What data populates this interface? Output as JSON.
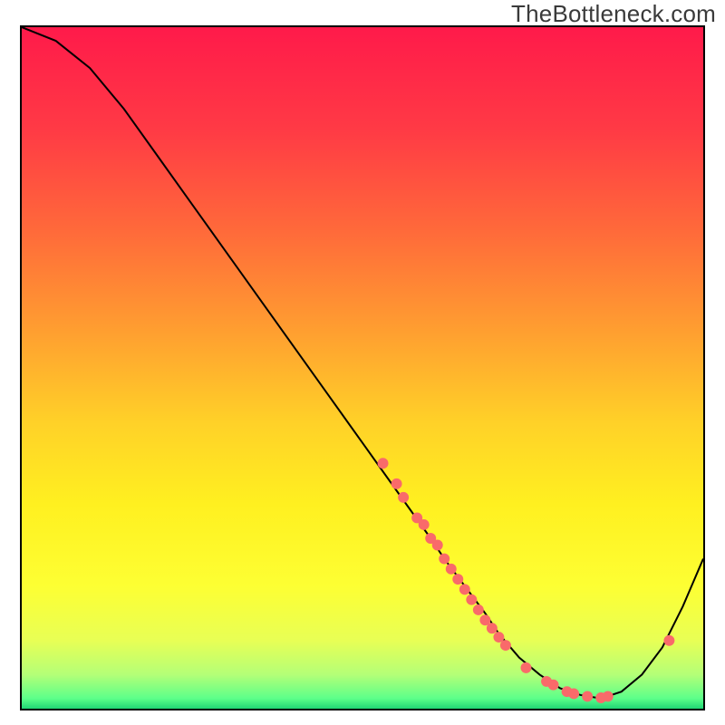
{
  "attribution": "TheBottleneck.com",
  "chart_data": {
    "type": "line",
    "title": "",
    "xlabel": "",
    "ylabel": "",
    "xlim": [
      0,
      100
    ],
    "ylim": [
      0,
      100
    ],
    "grid": false,
    "legend": false,
    "background_gradient": {
      "stops": [
        {
          "pos": 0.0,
          "color": "#ff1a4a"
        },
        {
          "pos": 0.15,
          "color": "#ff3a45"
        },
        {
          "pos": 0.3,
          "color": "#ff6a3a"
        },
        {
          "pos": 0.45,
          "color": "#ffa030"
        },
        {
          "pos": 0.58,
          "color": "#ffd128"
        },
        {
          "pos": 0.7,
          "color": "#fff020"
        },
        {
          "pos": 0.82,
          "color": "#fdff33"
        },
        {
          "pos": 0.9,
          "color": "#e8ff55"
        },
        {
          "pos": 0.95,
          "color": "#b4ff77"
        },
        {
          "pos": 0.985,
          "color": "#5cff8a"
        },
        {
          "pos": 1.0,
          "color": "#20d574"
        }
      ]
    },
    "series": [
      {
        "name": "bottleneck-curve",
        "color": "#000000",
        "x": [
          0,
          5,
          10,
          15,
          20,
          25,
          30,
          35,
          40,
          45,
          50,
          55,
          60,
          62,
          65,
          68,
          70,
          73,
          76,
          79,
          82,
          85,
          88,
          91,
          94,
          97,
          100
        ],
        "y": [
          100,
          98,
          94,
          88,
          81,
          74,
          67,
          60,
          53,
          46,
          39,
          32,
          25,
          22,
          18,
          14,
          11,
          7.5,
          5,
          3,
          2,
          1.5,
          2.5,
          5,
          9,
          15,
          22
        ]
      }
    ],
    "markers": [
      {
        "name": "dots",
        "color": "#f96a6a",
        "radius": 6,
        "points": [
          {
            "x": 53,
            "y": 36
          },
          {
            "x": 55,
            "y": 33
          },
          {
            "x": 56,
            "y": 31
          },
          {
            "x": 58,
            "y": 28
          },
          {
            "x": 59,
            "y": 27
          },
          {
            "x": 60,
            "y": 25
          },
          {
            "x": 61,
            "y": 24
          },
          {
            "x": 62,
            "y": 22
          },
          {
            "x": 63,
            "y": 20.5
          },
          {
            "x": 64,
            "y": 19
          },
          {
            "x": 65,
            "y": 17.5
          },
          {
            "x": 66,
            "y": 16
          },
          {
            "x": 67,
            "y": 14.5
          },
          {
            "x": 68,
            "y": 13
          },
          {
            "x": 69,
            "y": 11.8
          },
          {
            "x": 70,
            "y": 10.5
          },
          {
            "x": 71,
            "y": 9.3
          },
          {
            "x": 74,
            "y": 6
          },
          {
            "x": 77,
            "y": 4
          },
          {
            "x": 78,
            "y": 3.5
          },
          {
            "x": 80,
            "y": 2.5
          },
          {
            "x": 81,
            "y": 2.2
          },
          {
            "x": 83,
            "y": 1.8
          },
          {
            "x": 85,
            "y": 1.6
          },
          {
            "x": 86,
            "y": 1.8
          },
          {
            "x": 95,
            "y": 10
          }
        ]
      }
    ]
  }
}
